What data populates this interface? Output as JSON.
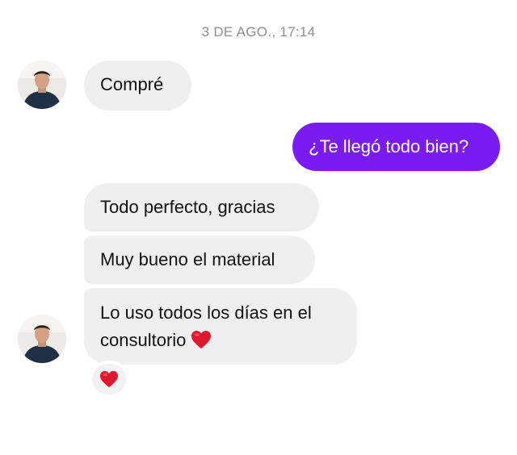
{
  "chat": {
    "timestamp": "3 DE AGO., 17:14",
    "messages": [
      {
        "direction": "incoming",
        "text": "Compré"
      },
      {
        "direction": "outgoing",
        "text": "¿Te llegó todo bien?"
      },
      {
        "direction": "incoming",
        "text": "Todo perfecto, gracias"
      },
      {
        "direction": "incoming",
        "text": "Muy bueno el material"
      },
      {
        "direction": "incoming",
        "line1": "Lo uso todos los días en el",
        "line2": "consultorio",
        "emoji": "heart-emoji"
      }
    ],
    "reaction": {
      "emoji": "heart-emoji"
    }
  },
  "colors": {
    "incoming_bubble": "#efefef",
    "outgoing_bubble": "#7a1bf2",
    "timestamp": "#8e8e93",
    "heart": "#e0182d"
  }
}
